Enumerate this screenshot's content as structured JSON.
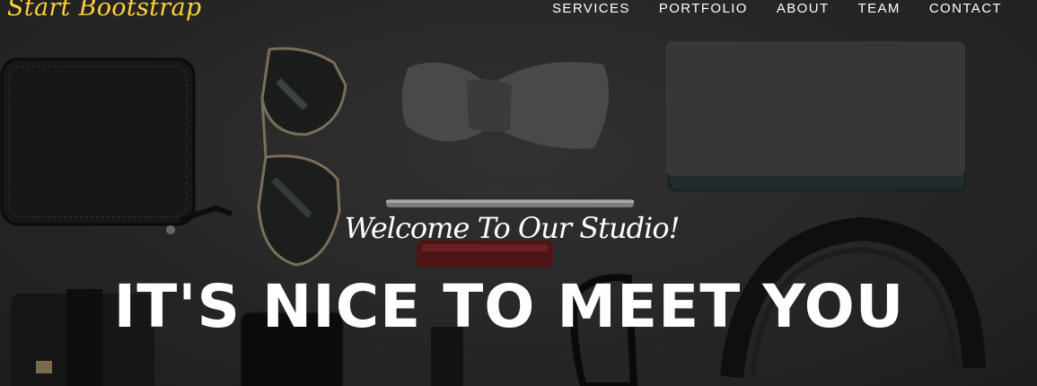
{
  "navbar": {
    "brand": "Start Bootstrap",
    "links": [
      "SERVICES",
      "PORTFOLIO",
      "ABOUT",
      "TEAM",
      "CONTACT"
    ]
  },
  "masthead": {
    "subheading": "Welcome To Our Studio!",
    "heading": "IT'S NICE TO MEET YOU"
  },
  "colors": {
    "brand": "#fed136",
    "text": "#ffffff",
    "background": "#2b2a2b"
  },
  "background_image": "flat-lay-accessories"
}
